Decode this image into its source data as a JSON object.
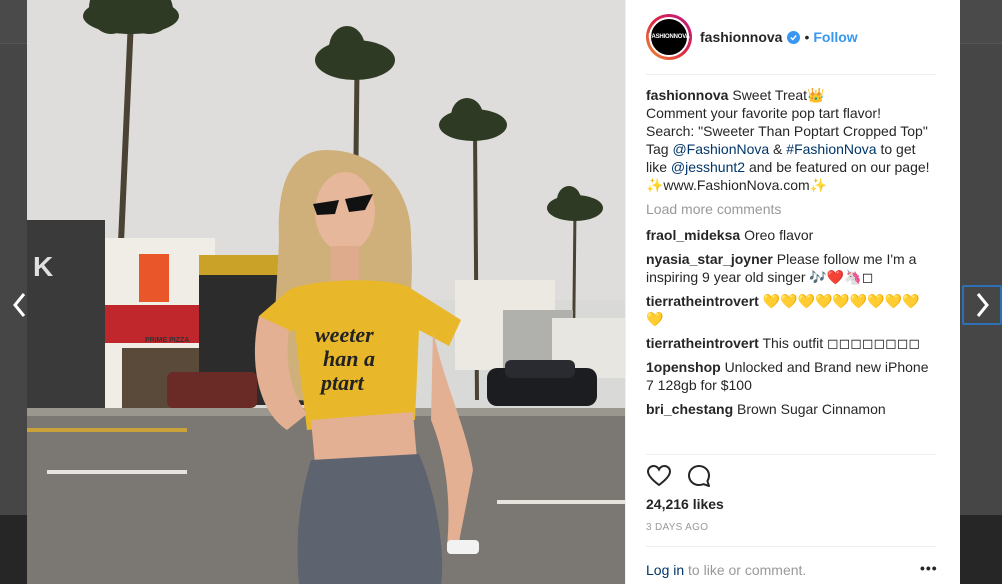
{
  "header": {
    "avatar_text": "FASHIONNOVA",
    "username": "fashionnova",
    "separator": "•",
    "follow_label": "Follow"
  },
  "caption": {
    "username": "fashionnova",
    "text_1": "Sweet Treat👑",
    "text_2": "Comment your favorite pop tart flavor!",
    "text_3": "Search: \"Sweeter Than Poptart Cropped Top\"",
    "text_4a": "Tag ",
    "tag_1": "@FashionNova",
    "text_4b": " & ",
    "tag_2": "#FashionNova",
    "text_4c": " to get like ",
    "tag_3": "@jesshunt2",
    "text_4d": " and be featured on our page!",
    "text_5": "✨www.FashionNova.com✨"
  },
  "load_more_label": "Load more comments",
  "comments": [
    {
      "user": "fraol_mideksa",
      "text": "Oreo flavor"
    },
    {
      "user": "nyasia_star_joyner",
      "text": "Please follow me I'm a inspiring 9 year old singer 🎶❤️🦄◻"
    },
    {
      "user": "tierratheintrovert",
      "text": "💛💛💛💛💛💛💛💛💛💛"
    },
    {
      "user": "tierratheintrovert",
      "text": "This outfit ◻◻◻◻◻◻◻◻"
    },
    {
      "user": "1openshop",
      "text": "Unlocked and Brand new iPhone 7 128gb for $100"
    },
    {
      "user": "bri_chestang",
      "text": "Brown Sugar Cinnamon"
    }
  ],
  "likes": "24,216 likes",
  "timestamp": "3 DAYS AGO",
  "footer": {
    "login_label": "Log in",
    "login_rest": " to like or comment.",
    "more_label": "•••"
  },
  "photo_text": {
    "shirt_line_1": "weeter",
    "shirt_line_2": "han a",
    "shirt_line_3": "ptart",
    "storefront_sign": "PRIME PIZZA",
    "storefront_letter": "K"
  },
  "icons": {
    "prev": "chevron-left-icon",
    "next": "chevron-right-icon",
    "like": "heart-icon",
    "comment": "comment-icon",
    "verified": "verified-badge-icon"
  },
  "colors": {
    "follow_blue": "#3897f0",
    "link_blue": "#003569",
    "shirt_yellow": "#e8b82a"
  }
}
